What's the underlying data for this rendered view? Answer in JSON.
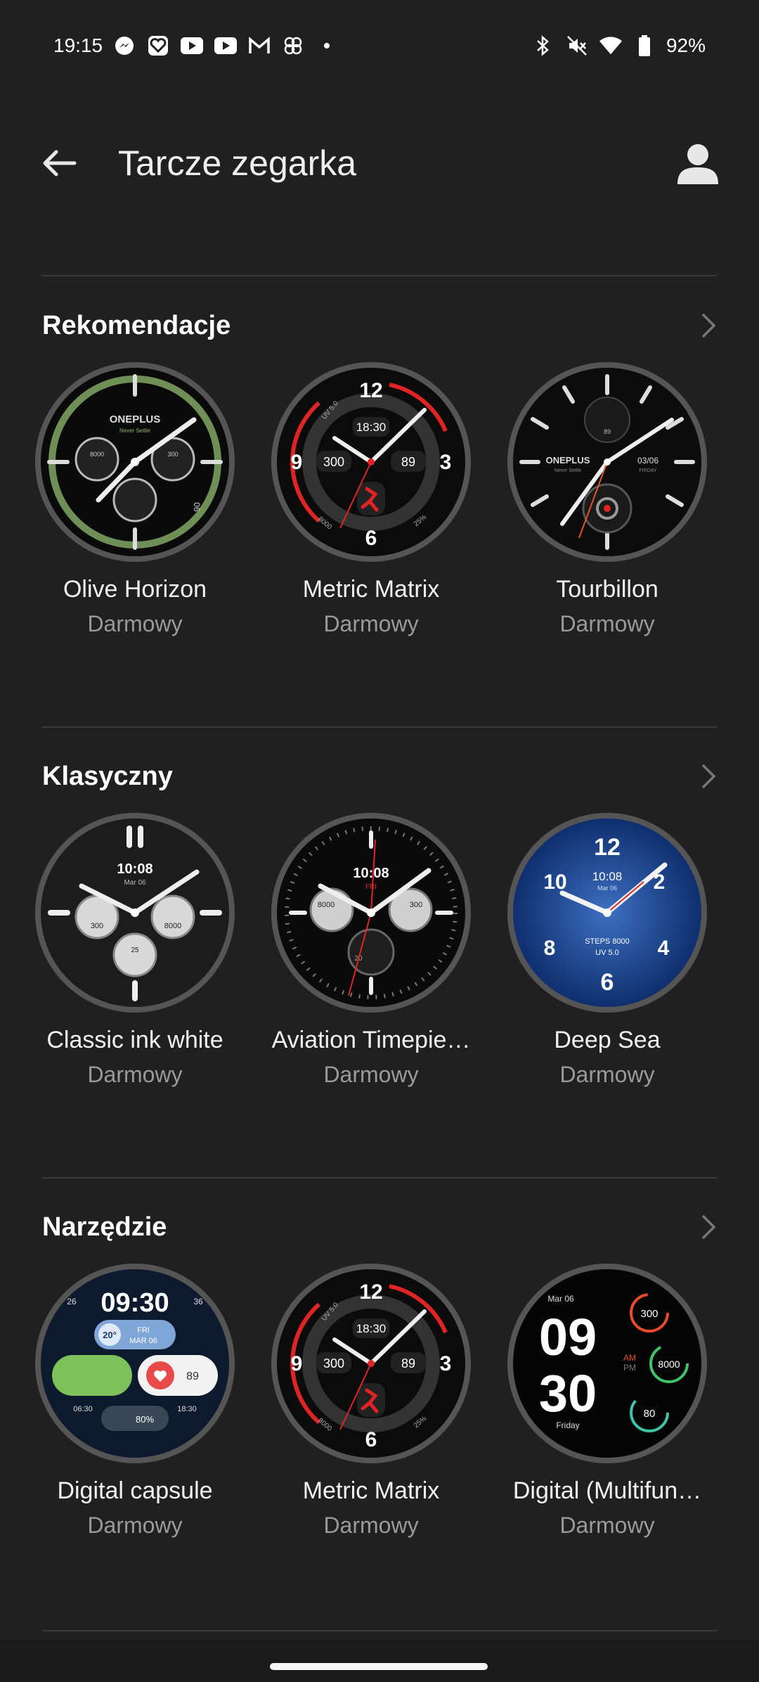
{
  "status": {
    "time": "19:15",
    "battery": "92%"
  },
  "header": {
    "title": "Tarcze zegarka"
  },
  "sections": [
    {
      "title": "Rekomendacje",
      "items": [
        {
          "name": "Olive Horizon",
          "price": "Darmowy"
        },
        {
          "name": "Metric Matrix",
          "price": "Darmowy"
        },
        {
          "name": "Tourbillon",
          "price": "Darmowy"
        }
      ]
    },
    {
      "title": "Klasyczny",
      "items": [
        {
          "name": "Classic ink white",
          "price": "Darmowy"
        },
        {
          "name": "Aviation Timepie…",
          "price": "Darmowy"
        },
        {
          "name": "Deep Sea",
          "price": "Darmowy"
        }
      ]
    },
    {
      "title": "Narzędzie",
      "items": [
        {
          "name": "Digital capsule",
          "price": "Darmowy"
        },
        {
          "name": "Metric Matrix",
          "price": "Darmowy"
        },
        {
          "name": "Digital (Multifun…",
          "price": "Darmowy"
        }
      ]
    }
  ],
  "faces": {
    "olive": {
      "brand": "ONEPLUS",
      "tagline": "Never Settle",
      "left_sub": "8000",
      "right_sub": "300",
      "date": "06"
    },
    "metric": {
      "hour12": "12",
      "hour3": "3",
      "hour6": "6",
      "hour9": "9",
      "time": "18:30",
      "left": "300",
      "right": "89",
      "uv": "UV 5.0",
      "steps": "8000",
      "battery": "25%"
    },
    "tourbillon": {
      "brand": "ONEPLUS",
      "tagline": "Never Settle",
      "date": "03/06",
      "day": "FRIDAY",
      "sub": "89"
    },
    "classic": {
      "time": "10:08",
      "date": "Mar 06",
      "left": "300",
      "right": "8000",
      "bottom": "25"
    },
    "aviation": {
      "time": "10:08",
      "day": "FRI",
      "left": "8000",
      "right": "300",
      "bottom": "20"
    },
    "deepsea": {
      "h12": "12",
      "h2": "2",
      "h4": "4",
      "h6": "6",
      "h8": "8",
      "h10": "10",
      "time": "10:08",
      "date": "Mar 06",
      "steps": "STEPS 8000",
      "uv": "UV 5.0"
    },
    "capsule": {
      "time": "09:30",
      "left_top": "26",
      "right_top": "36",
      "temp": "20°",
      "day": "FRI",
      "date": "MAR 06",
      "hr": "89",
      "sunrise": "06:30",
      "sunset": "18:30",
      "battery": "80%"
    },
    "multi": {
      "date": "Mar 06",
      "hour": "09",
      "minute": "30",
      "am": "AM",
      "pm": "PM",
      "day": "Friday",
      "ring1": "300",
      "ring2": "8000",
      "ring3": "80"
    }
  },
  "colors": {
    "background": "#202020",
    "divider": "#3a3a3a",
    "accent_red": "#e02424",
    "olive_green": "#6e8f55",
    "deepsea_blue": "#1e4fa3"
  }
}
